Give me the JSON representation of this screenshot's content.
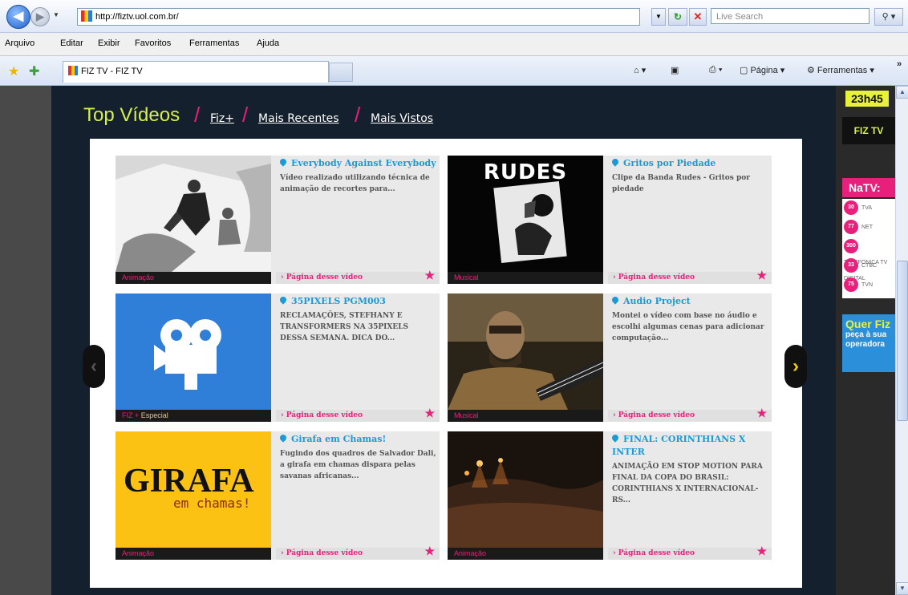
{
  "browser": {
    "url": "http://fiztv.uol.com.br/",
    "search_placeholder": "Live Search",
    "menu": [
      "Arquivo",
      "Editar",
      "Exibir",
      "Favoritos",
      "Ferramentas",
      "Ajuda"
    ],
    "tab_title": "FIZ TV - FIZ TV",
    "commands": {
      "page": "Página",
      "tools": "Ferramentas"
    }
  },
  "page": {
    "heading": "Top Vídeos",
    "links": [
      "Fiz+",
      "Mais Recentes",
      "Mais Vistos"
    ],
    "page_link_label": "› Página desse vídeo",
    "videos": [
      {
        "title": "Everybody Against Everybody",
        "desc": "Vídeo realizado utilizando técnica de animação de recortes para...",
        "category": "Animação",
        "extra": ""
      },
      {
        "title": "Gritos por Piedade",
        "desc": "Clipe da Banda Rudes - Gritos por piedade",
        "category": "Musical",
        "extra": "",
        "thumb_text": "RUDES"
      },
      {
        "title": "35PIXELS PGM003",
        "desc": "RECLAMAÇÕES, STEFHANY E TRANSFORMERS NA 35PIXELS DESSA SEMANA. DICA DO...",
        "category": "FIZ +",
        "extra": "Especial"
      },
      {
        "title": "Audio Project",
        "desc": "Montei o vídeo com base no áudio e escolhi algumas cenas para adicionar computação...",
        "category": "Musical",
        "extra": ""
      },
      {
        "title": "Girafa em Chamas!",
        "desc": "Fugindo dos quadros de Salvador Dali, a girafa em chamas dispara pelas savanas africanas...",
        "category": "Animação",
        "extra": "",
        "thumb_text": "GIRAFA",
        "thumb_sub": "em chamas!"
      },
      {
        "title": "FINAL: CORINTHIANS X INTER",
        "desc": "ANIMAÇÃO EM STOP MOTION PARA FINAL DA COPA DO BRASIL: CORINTHIANS X INTERNACIONAL-RS...",
        "category": "Animação",
        "extra": ""
      }
    ]
  },
  "sidebar": {
    "clock": "23h45",
    "logo": "FIZ TV",
    "natv_label": "NaTV:",
    "channels": [
      {
        "num": "30",
        "name": "TVA"
      },
      {
        "num": "77",
        "name": "NET"
      },
      {
        "num": "300",
        "name": "TELEFONICA TV DIGITAL"
      },
      {
        "num": "33",
        "name": "CTBC"
      },
      {
        "num": "75",
        "name": "TVN"
      }
    ],
    "promo_big": "Quer Fiz",
    "promo_small": "peça à sua operadora"
  },
  "colors": {
    "accent": "#e8207b",
    "heading": "#d8f04a",
    "title": "#1a9ad8",
    "panel": "#15202e"
  }
}
